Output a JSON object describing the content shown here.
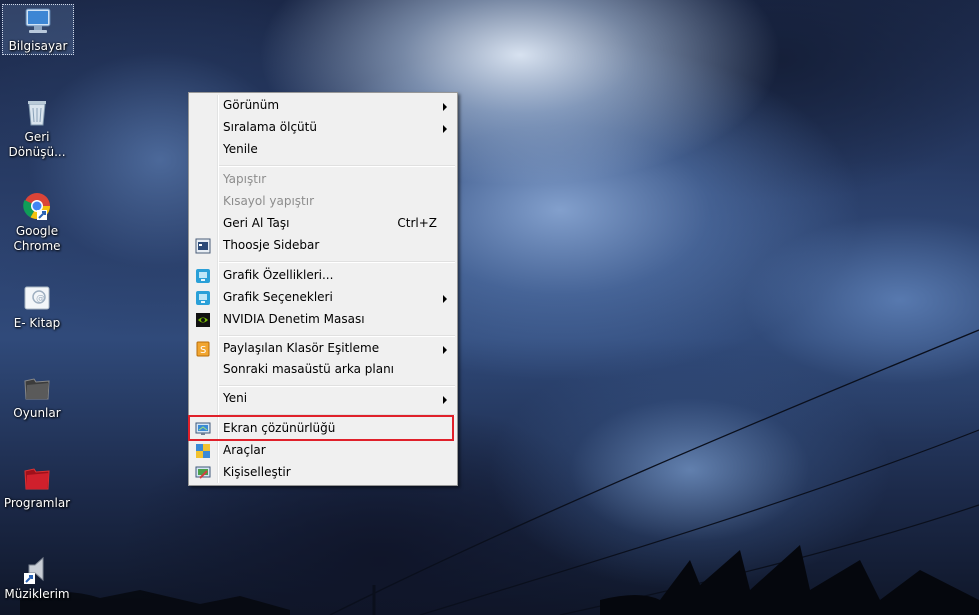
{
  "desktop": {
    "icons": [
      {
        "label": "Bilgisayar",
        "icon": "computer-icon"
      },
      {
        "label": "Geri Dönüşü...",
        "icon": "recycle-bin-icon"
      },
      {
        "label": "Google Chrome",
        "icon": "chrome-icon"
      },
      {
        "label": "E- Kitap",
        "icon": "ebook-folder-icon"
      },
      {
        "label": "Oyunlar",
        "icon": "games-folder-icon"
      },
      {
        "label": "Programlar",
        "icon": "programs-folder-icon"
      },
      {
        "label": "Müziklerim",
        "icon": "music-shortcut-icon"
      }
    ]
  },
  "context_menu": {
    "items": [
      {
        "label": "Görünüm",
        "submenu": true
      },
      {
        "label": "Sıralama ölçütü",
        "submenu": true
      },
      {
        "label": "Yenile"
      },
      {
        "label": "Yapıştır",
        "disabled": true
      },
      {
        "label": "Kısayol yapıştır",
        "disabled": true
      },
      {
        "label": "Geri Al Taşı",
        "shortcut": "Ctrl+Z"
      },
      {
        "label": "Thoosje Sidebar",
        "icon": "sidebar-icon"
      },
      {
        "label": "Grafik Özellikleri...",
        "icon": "graphics-properties-icon"
      },
      {
        "label": "Grafik Seçenekleri",
        "icon": "graphics-options-icon",
        "submenu": true
      },
      {
        "label": "NVIDIA Denetim Masası",
        "icon": "nvidia-icon"
      },
      {
        "label": "Paylaşılan Klasör Eşitleme",
        "icon": "shared-folder-sync-icon",
        "submenu": true
      },
      {
        "label": "Sonraki masaüstü arka planı"
      },
      {
        "label": "Yeni",
        "submenu": true
      },
      {
        "label": "Ekran çözünürlüğü",
        "icon": "display-resolution-icon",
        "highlighted": true
      },
      {
        "label": "Araçlar",
        "icon": "tools-icon"
      },
      {
        "label": "Kişiselleştir",
        "icon": "personalize-icon"
      }
    ]
  },
  "colors": {
    "highlight_border": "#e0202a",
    "menu_background": "#f0f0f0"
  }
}
